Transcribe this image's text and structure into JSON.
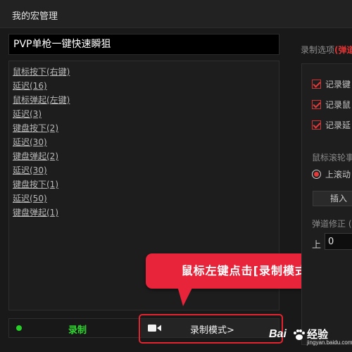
{
  "window": {
    "title": "我的宏管理"
  },
  "macro": {
    "name": "PVP单枪一键快速瞬狙"
  },
  "steps": [
    "鼠标按下(右键)",
    "延迟(16)",
    "鼠标弹起(左键)",
    "延迟(3)",
    "键盘按下(2)",
    "延迟(30)",
    "键盘弹起(2)",
    "延迟(30)",
    "键盘按下(1)",
    "延迟(50)",
    "键盘弹起(1)"
  ],
  "bottom_bar": {
    "record_label": "录制",
    "mode_label": "录制模式>"
  },
  "callout": {
    "text": "鼠标左键点击[录制模式]"
  },
  "options": {
    "header_prefix": "录制选项",
    "header_accent": "(弹道",
    "check_1": "记录键",
    "check_2": "记录鼠",
    "check_3": "记录延",
    "wheel_label": "鼠标滚轮事",
    "wheel_radio": "上滚动",
    "insert_label": "插入",
    "trajectory_label": "弹道修正 (",
    "up_label": "上",
    "up_value": "0"
  },
  "watermark": {
    "brand": "Bai",
    "suffix": "经验",
    "url": "jingyan.baidu.com"
  },
  "colors": {
    "accent_red": "#e8243a",
    "record_green": "#2fd62f",
    "background": "#191919"
  }
}
